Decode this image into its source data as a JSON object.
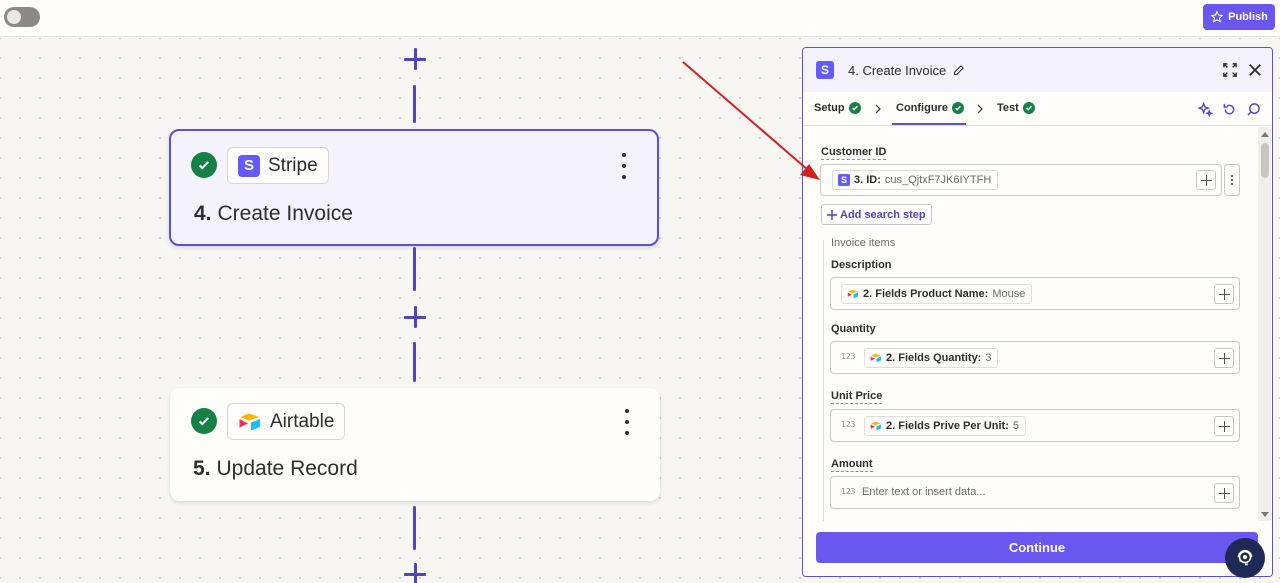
{
  "topbar": {
    "publish_label": "Publish"
  },
  "steps": [
    {
      "app": "Stripe",
      "number": "4.",
      "title": "Create Invoice",
      "status": "complete",
      "selected": true
    },
    {
      "app": "Airtable",
      "number": "5.",
      "title": "Update Record",
      "status": "complete",
      "selected": false
    }
  ],
  "panel": {
    "title": "4. Create Invoice",
    "tabs": [
      {
        "label": "Setup",
        "status": "complete"
      },
      {
        "label": "Configure",
        "status": "complete",
        "active": true
      },
      {
        "label": "Test",
        "status": "complete"
      }
    ],
    "customer_id": {
      "label": "Customer ID",
      "token_label": "3. ID:",
      "token_value": "cus_QjtxF7JK6IYTFH"
    },
    "add_search_step_label": "Add search step",
    "invoice_items_label": "Invoice items",
    "description": {
      "label": "Description",
      "token_label": "2. Fields Product Name:",
      "token_value": "Mouse"
    },
    "quantity": {
      "label": "Quantity",
      "type_hint": "123",
      "token_label": "2. Fields Quantity:",
      "token_value": "3"
    },
    "unit_price": {
      "label": "Unit Price",
      "type_hint": "123",
      "token_label": "2. Fields Prive Per Unit:",
      "token_value": "5"
    },
    "amount": {
      "label": "Amount",
      "type_hint": "123",
      "placeholder": "Enter text or insert data..."
    },
    "continue_label": "Continue"
  },
  "colors": {
    "accent": "#6a57f0",
    "connector": "#4f45c4",
    "success": "#168146",
    "stripe": "#635bff",
    "annotation_arrow": "#d42020"
  }
}
